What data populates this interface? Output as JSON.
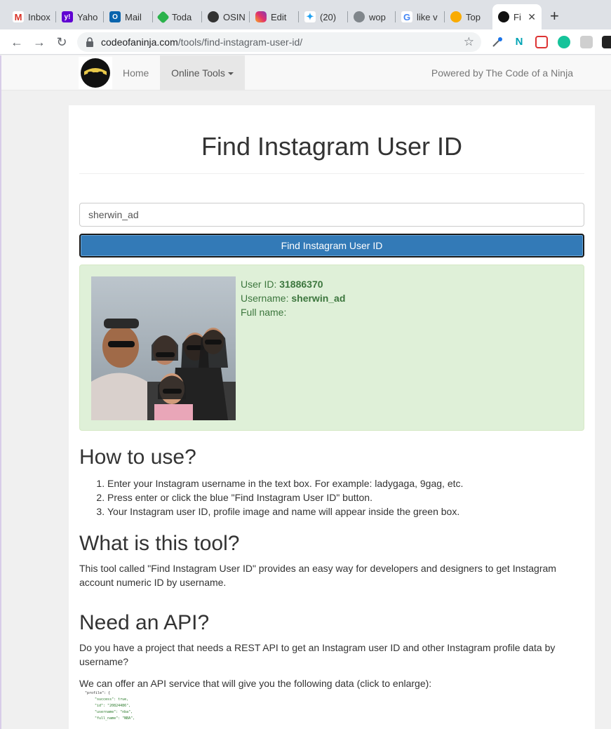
{
  "browser": {
    "tabs": [
      {
        "label": "Inbox",
        "icon": "gmail-icon"
      },
      {
        "label": "Yaho",
        "icon": "yahoo-icon"
      },
      {
        "label": "Mail",
        "icon": "outlook-icon"
      },
      {
        "label": "Toda",
        "icon": "feedly-icon"
      },
      {
        "label": "OSIN",
        "icon": "globe-icon"
      },
      {
        "label": "Edit",
        "icon": "instagram-icon"
      },
      {
        "label": "(20)",
        "icon": "twitter-icon"
      },
      {
        "label": "wop",
        "icon": "globe-icon"
      },
      {
        "label": "like v",
        "icon": "google-icon"
      },
      {
        "label": "Top",
        "icon": "search-icon"
      },
      {
        "label": "Fi",
        "icon": "ninja-icon"
      }
    ],
    "new_tab_label": "+",
    "url_domain": "codeofaninja.com",
    "url_path": "/tools/find-instagram-user-id/"
  },
  "navbar": {
    "home_label": "Home",
    "tools_label": "Online Tools",
    "powered_label": "Powered by The Code of a Ninja"
  },
  "main": {
    "title": "Find Instagram User ID",
    "input_value": "sherwin_ad",
    "button_label": "Find Instagram User ID",
    "result": {
      "user_id_label": "User ID:",
      "user_id_value": "31886370",
      "username_label": "Username:",
      "username_value": "sherwin_ad",
      "fullname_label": "Full name:"
    },
    "how_heading": "How to use?",
    "steps": [
      "Enter your Instagram username in the text box. For example: ladygaga, 9gag, etc.",
      "Press enter or click the blue \"Find Instagram User ID\" button.",
      "Your Instagram user ID, profile image and name will appear inside the green box."
    ],
    "what_heading": "What is this tool?",
    "what_text": "This tool called \"Find Instagram User ID\" provides an easy way for developers and designers to get Instagram account numeric ID by username.",
    "api_heading": "Need an API?",
    "api_text1": "Do you have a project that needs a REST API to get an Instagram user ID and other Instagram profile data by username?",
    "api_text2": "We can offer an API service that will give you the following data (click to enlarge):",
    "code_lines": [
      "\"profile\": {",
      "\"success\": true,",
      "\"id\": \"20824486\",",
      "\"username\": \"nba\",",
      "\"full_name\": \"NBA\","
    ]
  }
}
